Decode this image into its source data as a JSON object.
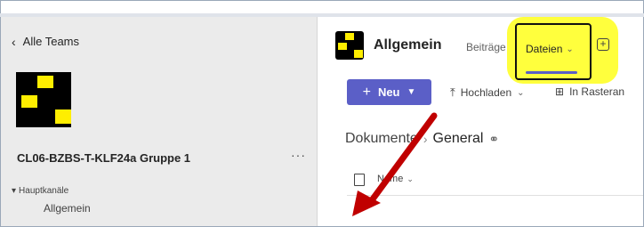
{
  "sidebar": {
    "back_label": "Alle Teams",
    "team_name": "CL06-BZBS-T-KLF24a Gruppe 1",
    "more_label": "···",
    "channels_header": "Hauptkanäle",
    "channels": [
      {
        "label": "Allgemein"
      }
    ]
  },
  "header": {
    "channel_title": "Allgemein",
    "tabs": [
      {
        "label": "Beiträge"
      },
      {
        "label": "Dateien"
      }
    ]
  },
  "toolbar": {
    "new_label": "Neu",
    "upload_label": "Hochladen",
    "grid_label": "In Rasteran"
  },
  "breadcrumb": {
    "root": "Dokumente",
    "current": "General"
  },
  "file_list": {
    "columns": [
      "Name"
    ]
  },
  "colors": {
    "accent": "#5b5fc7",
    "highlight": "#ffff33",
    "annotation_arrow": "#c00000"
  },
  "icons": [
    "chevron-left-icon",
    "more-icon",
    "chevron-down-icon",
    "add-tab-icon",
    "plus-icon",
    "upload-icon",
    "grid-icon",
    "people-icon",
    "file-icon"
  ]
}
